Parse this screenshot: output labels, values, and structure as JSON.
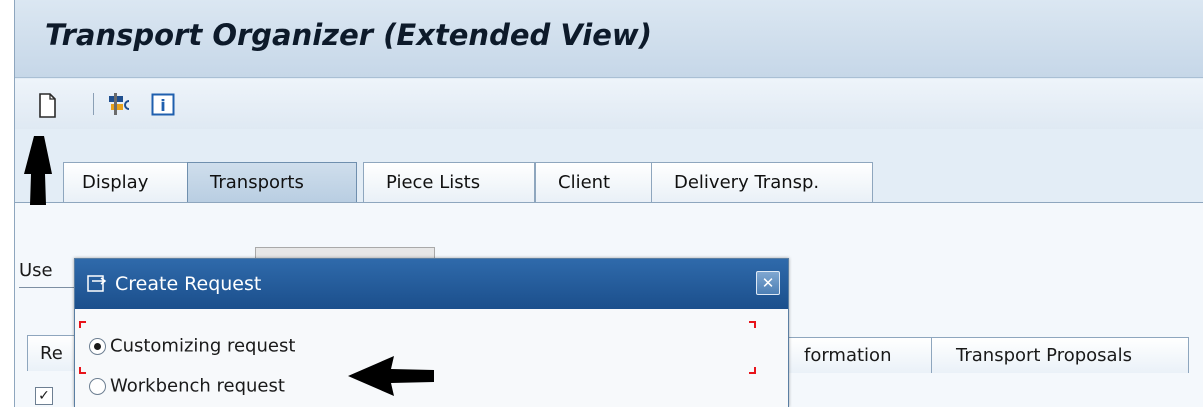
{
  "window": {
    "title": "Transport Organizer (Extended View)"
  },
  "toolbar": {
    "buttons": [
      {
        "icon": "new-document-icon"
      },
      {
        "icon": "transport-tools-icon"
      },
      {
        "icon": "information-icon",
        "glyph": "i"
      }
    ]
  },
  "tabs": [
    {
      "label": "Display",
      "active": false
    },
    {
      "label": "Transports",
      "active": true
    },
    {
      "label": "Piece Lists",
      "active": false
    },
    {
      "label": "Client",
      "active": false
    },
    {
      "label": "Delivery Transp.",
      "active": false
    }
  ],
  "panel": {
    "user_label": "Use",
    "subtabs": [
      {
        "label": "Re"
      },
      {
        "label": "formation"
      },
      {
        "label": "Transport Proposals"
      }
    ],
    "checkbox_mark": "✓"
  },
  "dialog": {
    "title": "Create Request",
    "close_glyph": "✕",
    "options": [
      {
        "label": "Customizing request",
        "selected": true
      },
      {
        "label": "Workbench request",
        "selected": false
      }
    ]
  },
  "colors": {
    "title_bar": "#c6d7e8",
    "dialog_header": "#1b4f8c",
    "focus_corners": "#e8141b",
    "annotation_arrows": "#000000"
  }
}
